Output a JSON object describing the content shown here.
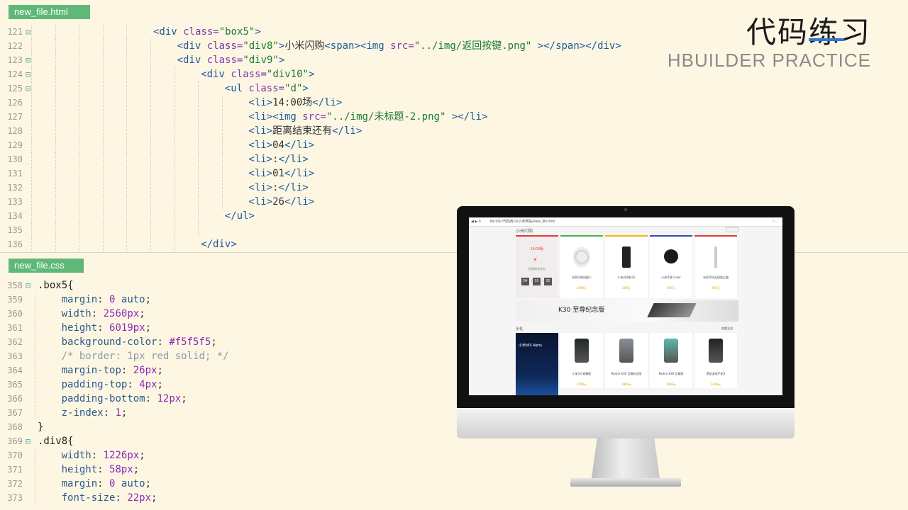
{
  "header": {
    "title_cn": "代码练习",
    "title_en": "HBUILDER PRACTICE",
    "accent": "#2f7ad0"
  },
  "tabs": {
    "html_file": "new_file.html",
    "css_file": "new_file.css",
    "tab_color": "#5fb878"
  },
  "html_code": [
    {
      "n": "121",
      "fold": "⊟",
      "indent": 5,
      "segs": [
        [
          "tag",
          "<div "
        ],
        [
          "attr",
          "class="
        ],
        [
          "str",
          "\"box5\""
        ],
        [
          "tag",
          ">"
        ]
      ]
    },
    {
      "n": "122",
      "fold": "",
      "indent": 6,
      "segs": [
        [
          "tag",
          "<div "
        ],
        [
          "attr",
          "class="
        ],
        [
          "str",
          "\"div8\""
        ],
        [
          "tag",
          ">"
        ],
        [
          "txt",
          "小米闪购"
        ],
        [
          "tag",
          "<span><img "
        ],
        [
          "attr",
          "src="
        ],
        [
          "str",
          "\"../img/返回按键.png\""
        ],
        [
          "tag",
          " ></span></div>"
        ]
      ]
    },
    {
      "n": "123",
      "fold": "⊟",
      "indent": 6,
      "segs": [
        [
          "tag",
          "<div "
        ],
        [
          "attr",
          "class="
        ],
        [
          "str",
          "\"div9\""
        ],
        [
          "tag",
          ">"
        ]
      ]
    },
    {
      "n": "124",
      "fold": "⊟",
      "indent": 7,
      "segs": [
        [
          "tag",
          "<div "
        ],
        [
          "attr",
          "class="
        ],
        [
          "str",
          "\"div10\""
        ],
        [
          "tag",
          ">"
        ]
      ]
    },
    {
      "n": "125",
      "fold": "⊟",
      "indent": 8,
      "segs": [
        [
          "tag",
          "<ul "
        ],
        [
          "attr",
          "class="
        ],
        [
          "str",
          "\"d\""
        ],
        [
          "tag",
          ">"
        ]
      ]
    },
    {
      "n": "126",
      "fold": "",
      "indent": 9,
      "segs": [
        [
          "tag",
          "<li>"
        ],
        [
          "txt",
          "14:00场"
        ],
        [
          "tag",
          "</li>"
        ]
      ]
    },
    {
      "n": "127",
      "fold": "",
      "indent": 9,
      "segs": [
        [
          "tag",
          "<li><img "
        ],
        [
          "attr",
          "src="
        ],
        [
          "str",
          "\"../img/未标题-2.png\""
        ],
        [
          "tag",
          " ></li>"
        ]
      ]
    },
    {
      "n": "128",
      "fold": "",
      "indent": 9,
      "segs": [
        [
          "tag",
          "<li>"
        ],
        [
          "txt",
          "距离结束还有"
        ],
        [
          "tag",
          "</li>"
        ]
      ]
    },
    {
      "n": "129",
      "fold": "",
      "indent": 9,
      "segs": [
        [
          "tag",
          "<li>"
        ],
        [
          "txt",
          "04"
        ],
        [
          "tag",
          "</li>"
        ]
      ]
    },
    {
      "n": "130",
      "fold": "",
      "indent": 9,
      "segs": [
        [
          "tag",
          "<li>"
        ],
        [
          "txt",
          ":"
        ],
        [
          "tag",
          "</li>"
        ]
      ]
    },
    {
      "n": "131",
      "fold": "",
      "indent": 9,
      "segs": [
        [
          "tag",
          "<li>"
        ],
        [
          "txt",
          "01"
        ],
        [
          "tag",
          "</li>"
        ]
      ]
    },
    {
      "n": "132",
      "fold": "",
      "indent": 9,
      "segs": [
        [
          "tag",
          "<li>"
        ],
        [
          "txt",
          ":"
        ],
        [
          "tag",
          "</li>"
        ]
      ]
    },
    {
      "n": "133",
      "fold": "",
      "indent": 9,
      "segs": [
        [
          "tag",
          "<li>"
        ],
        [
          "txt",
          "26"
        ],
        [
          "tag",
          "</li>"
        ]
      ]
    },
    {
      "n": "134",
      "fold": "",
      "indent": 8,
      "segs": [
        [
          "tag",
          "</ul>"
        ]
      ]
    },
    {
      "n": "135",
      "fold": "",
      "indent": 8,
      "segs": []
    },
    {
      "n": "136",
      "fold": "",
      "indent": 7,
      "segs": [
        [
          "tag",
          "</div>"
        ]
      ]
    }
  ],
  "css_code": [
    {
      "n": "358",
      "fold": "⊟",
      "indent": 0,
      "segs": [
        [
          "sel",
          ".box5{"
        ]
      ]
    },
    {
      "n": "359",
      "fold": "",
      "indent": 1,
      "segs": [
        [
          "prop",
          "margin"
        ],
        [
          "punc",
          ": "
        ],
        [
          "num",
          "0"
        ],
        [
          "prop",
          " auto"
        ],
        [
          "punc",
          ";"
        ]
      ]
    },
    {
      "n": "360",
      "fold": "",
      "indent": 1,
      "segs": [
        [
          "prop",
          "width"
        ],
        [
          "punc",
          ": "
        ],
        [
          "num",
          "2560px"
        ],
        [
          "punc",
          ";"
        ]
      ]
    },
    {
      "n": "361",
      "fold": "",
      "indent": 1,
      "segs": [
        [
          "prop",
          "height"
        ],
        [
          "punc",
          ": "
        ],
        [
          "num",
          "6019px"
        ],
        [
          "punc",
          ";"
        ]
      ]
    },
    {
      "n": "362",
      "fold": "",
      "indent": 1,
      "segs": [
        [
          "prop",
          "background-color"
        ],
        [
          "punc",
          ": "
        ],
        [
          "num",
          "#f5f5f5"
        ],
        [
          "punc",
          ";"
        ]
      ]
    },
    {
      "n": "363",
      "fold": "",
      "indent": 1,
      "segs": [
        [
          "cmt",
          "/* border: 1px red solid; */"
        ]
      ]
    },
    {
      "n": "364",
      "fold": "",
      "indent": 1,
      "segs": [
        [
          "prop",
          "margin-top"
        ],
        [
          "punc",
          ": "
        ],
        [
          "num",
          "26px"
        ],
        [
          "punc",
          ";"
        ]
      ]
    },
    {
      "n": "365",
      "fold": "",
      "indent": 1,
      "segs": [
        [
          "prop",
          "padding-top"
        ],
        [
          "punc",
          ": "
        ],
        [
          "num",
          "4px"
        ],
        [
          "punc",
          ";"
        ]
      ]
    },
    {
      "n": "366",
      "fold": "",
      "indent": 1,
      "segs": [
        [
          "prop",
          "padding-bottom"
        ],
        [
          "punc",
          ": "
        ],
        [
          "num",
          "12px"
        ],
        [
          "punc",
          ";"
        ]
      ]
    },
    {
      "n": "367",
      "fold": "",
      "indent": 1,
      "segs": [
        [
          "prop",
          "z-index"
        ],
        [
          "punc",
          ": "
        ],
        [
          "num",
          "1"
        ],
        [
          "punc",
          ";"
        ]
      ]
    },
    {
      "n": "368",
      "fold": "",
      "indent": 0,
      "segs": [
        [
          "sel",
          "}"
        ]
      ]
    },
    {
      "n": "369",
      "fold": "⊟",
      "indent": 0,
      "segs": [
        [
          "sel",
          ".div8{"
        ]
      ]
    },
    {
      "n": "370",
      "fold": "",
      "indent": 1,
      "segs": [
        [
          "prop",
          "width"
        ],
        [
          "punc",
          ": "
        ],
        [
          "num",
          "1226px"
        ],
        [
          "punc",
          ";"
        ]
      ]
    },
    {
      "n": "371",
      "fold": "",
      "indent": 1,
      "segs": [
        [
          "prop",
          "height"
        ],
        [
          "punc",
          ": "
        ],
        [
          "num",
          "58px"
        ],
        [
          "punc",
          ";"
        ]
      ]
    },
    {
      "n": "372",
      "fold": "",
      "indent": 1,
      "segs": [
        [
          "prop",
          "margin"
        ],
        [
          "punc",
          ": "
        ],
        [
          "num",
          "0"
        ],
        [
          "prop",
          " auto"
        ],
        [
          "punc",
          ";"
        ]
      ]
    },
    {
      "n": "373",
      "fold": "",
      "indent": 1,
      "segs": [
        [
          "prop",
          "font-size"
        ],
        [
          "punc",
          ": "
        ],
        [
          "num",
          "22px"
        ],
        [
          "punc",
          ";"
        ]
      ]
    }
  ],
  "monitor": {
    "url": "file:///E:/代码练习/小米网站/view_file.html",
    "site_heading": "小米闪购",
    "flash_sale": {
      "session": "14:00场",
      "ends_in": "距离结束还有",
      "countdown": [
        "04",
        "01",
        "26"
      ]
    },
    "products": [
      {
        "name": "米家扫地机器人",
        "price": "1699元",
        "accent": "#4caf50"
      },
      {
        "name": "小米对讲机2S",
        "price": "249元",
        "accent": "#f4b400"
      },
      {
        "name": "小米手表 Color",
        "price": "699元",
        "accent": "#3949ab"
      },
      {
        "name": "米家手持无线吸尘器",
        "price": "899元",
        "accent": "#e53935"
      }
    ],
    "banner_text": "K30 至尊纪念版",
    "phone_section": "手机",
    "view_all": "查看全部",
    "mix_label": "小米MIX Alpha",
    "phones": [
      {
        "name": "小米10 青春版",
        "price": "2099元",
        "color": "#1f2a24"
      },
      {
        "name": "Redmi K30 至尊纪念版",
        "price": "1999元",
        "color": "#8a8f96"
      },
      {
        "name": "Redmi K30 至尊版",
        "price": "1999元",
        "color": "#5fb8b0"
      },
      {
        "name": "黑鲨游戏手机3",
        "price": "3499元",
        "color": "#222222"
      }
    ]
  }
}
